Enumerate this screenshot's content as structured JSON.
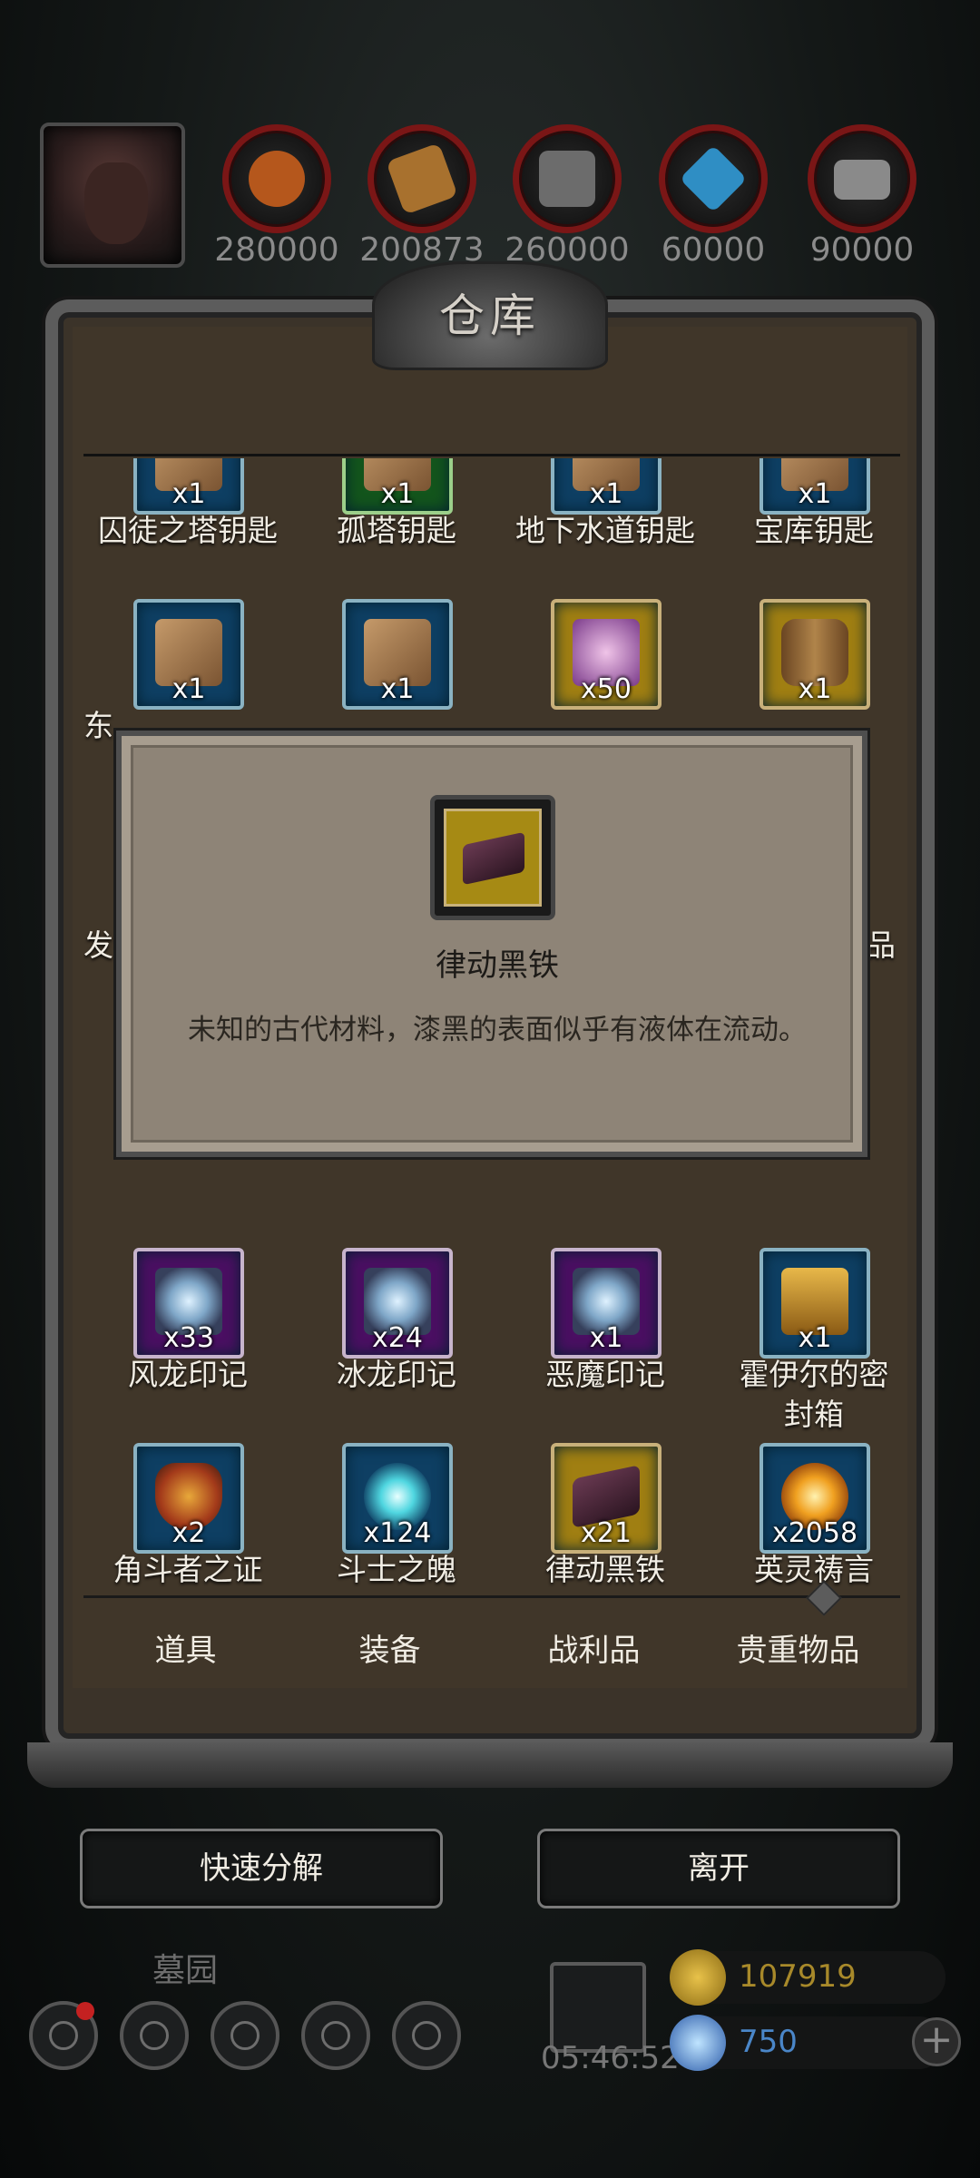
{
  "topbar": {
    "resources": [
      {
        "icon": "leather-icon",
        "value": "280000",
        "color": "#b5571c"
      },
      {
        "icon": "wood-icon",
        "value": "200873",
        "color": "#a8712e"
      },
      {
        "icon": "iron-ore-icon",
        "value": "260000",
        "color": "#6c6c6c"
      },
      {
        "icon": "crystal-icon",
        "value": "60000",
        "color": "#2f8ec4"
      },
      {
        "icon": "iron-ingot-icon",
        "value": "90000",
        "color": "#8a8a8a"
      }
    ]
  },
  "panel": {
    "title": "仓库",
    "items": [
      {
        "name": "囚徒之塔钥匙",
        "qty": "x1",
        "rarity": "blue",
        "icon": "key-icon"
      },
      {
        "name": "孤塔钥匙",
        "qty": "x1",
        "rarity": "green",
        "icon": "key-icon"
      },
      {
        "name": "地下水道钥匙",
        "qty": "x1",
        "rarity": "blue",
        "icon": "key-icon"
      },
      {
        "name": "宝库钥匙",
        "qty": "x1",
        "rarity": "blue",
        "icon": "key-icon"
      },
      {
        "name": "东",
        "qty": "x1",
        "rarity": "blue",
        "icon": "key-icon"
      },
      {
        "name": "",
        "qty": "x1",
        "rarity": "blue",
        "icon": "key-icon"
      },
      {
        "name": "",
        "qty": "x50",
        "rarity": "gold",
        "icon": "crystal-shard-icon"
      },
      {
        "name": "",
        "qty": "x1",
        "rarity": "gold",
        "icon": "barrel-icon"
      },
      {
        "name": "风龙印记",
        "qty": "x33",
        "rarity": "purple",
        "icon": "wind-swirl-icon"
      },
      {
        "name": "冰龙印记",
        "qty": "x24",
        "rarity": "purple",
        "icon": "wind-swirl-icon"
      },
      {
        "name": "恶魔印记",
        "qty": "x1",
        "rarity": "purple",
        "icon": "wind-swirl-icon"
      },
      {
        "name": "霍伊尔的密封箱",
        "qty": "x1",
        "rarity": "blue",
        "icon": "treasure-chest-icon"
      },
      {
        "name": "角斗者之证",
        "qty": "x2",
        "rarity": "blue",
        "icon": "shield-emblem-icon"
      },
      {
        "name": "斗士之魄",
        "qty": "x124",
        "rarity": "blue",
        "icon": "spirit-flame-icon"
      },
      {
        "name": "律动黑铁",
        "qty": "x21",
        "rarity": "gold",
        "icon": "black-iron-icon"
      },
      {
        "name": "英灵祷言",
        "qty": "x2058",
        "rarity": "blue",
        "icon": "golden-orb-icon"
      }
    ],
    "side_fragments": [
      "发",
      "品"
    ],
    "tabs": [
      "道具",
      "装备",
      "战利品",
      "贵重物品"
    ]
  },
  "buttons": {
    "quick_decompose": "快速分解",
    "leave": "离开"
  },
  "hud": {
    "place": "墓园",
    "timer": "05:46:52",
    "gold": "107919",
    "gems": "750",
    "gold_color": "#a8892a",
    "gem_color": "#4a86c8"
  },
  "popup": {
    "title": "律动黑铁",
    "description": "未知的古代材料，漆黑的表面似乎有液体在流动。"
  }
}
